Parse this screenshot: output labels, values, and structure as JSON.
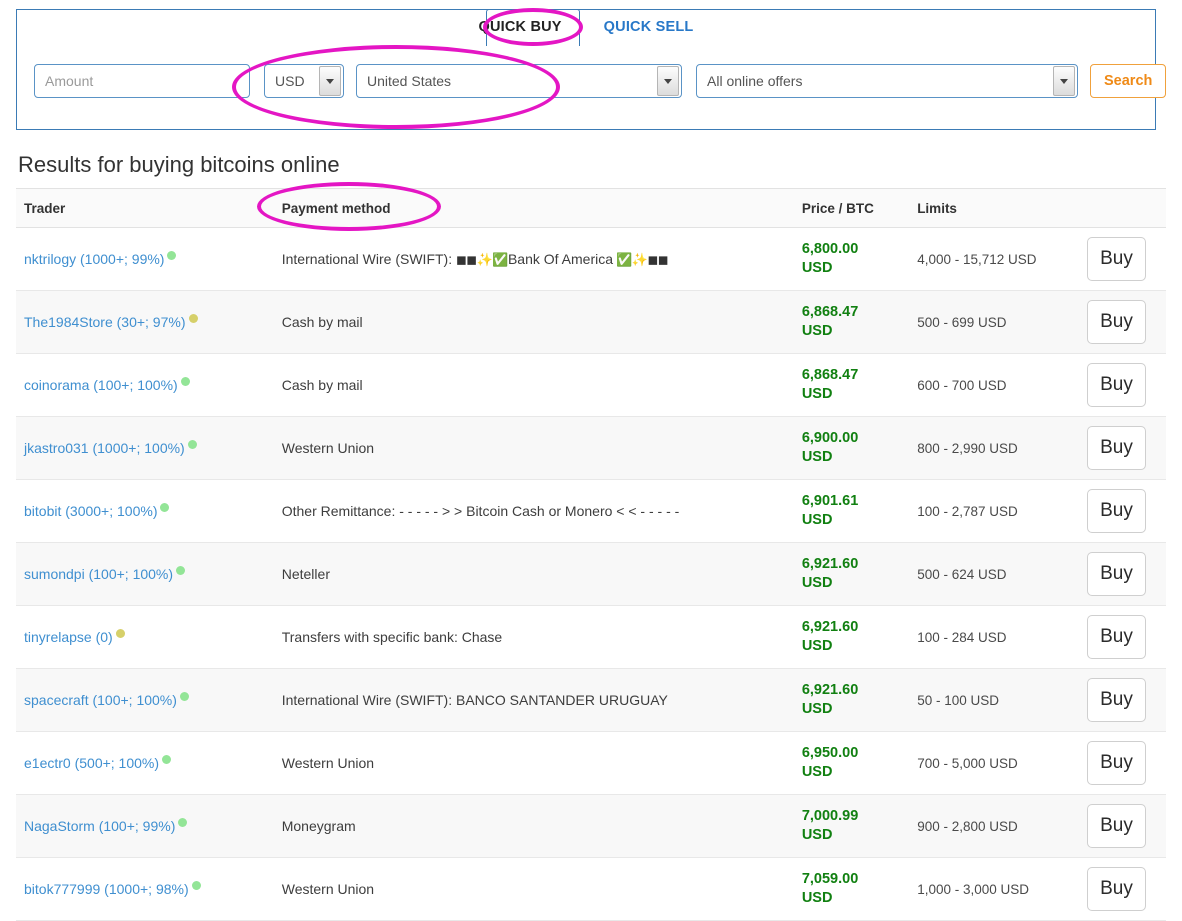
{
  "tabs": [
    {
      "label": "QUICK BUY",
      "state": "active"
    },
    {
      "label": "QUICK SELL",
      "state": "inactive"
    }
  ],
  "search": {
    "amount_placeholder": "Amount",
    "currency_value": "USD",
    "country_value": "United States",
    "offers_value": "All online offers",
    "search_label": "Search"
  },
  "results": {
    "heading": "Results for buying bitcoins online",
    "columns": [
      "Trader",
      "Payment method",
      "Price / BTC",
      "Limits",
      ""
    ],
    "buy_label": "Buy",
    "rows": [
      {
        "trader": "nktrilogy (1000+; 99%)",
        "status": "green",
        "payment": "International Wire (SWIFT): ",
        "payment_emoji_pre": "◼◼✨✅",
        "payment_bank": "Bank Of America",
        "payment_emoji_post": " ✅✨◼◼",
        "price": "6,800.00",
        "currency": "USD",
        "limits": "4,000 - 15,712 USD"
      },
      {
        "trader": "The1984Store (30+; 97%)",
        "status": "yellow",
        "payment": "Cash by mail",
        "price": "6,868.47",
        "currency": "USD",
        "limits": "500 - 699 USD"
      },
      {
        "trader": "coinorama (100+; 100%)",
        "status": "green",
        "payment": "Cash by mail",
        "price": "6,868.47",
        "currency": "USD",
        "limits": "600 - 700 USD"
      },
      {
        "trader": "jkastro031 (1000+; 100%)",
        "status": "green",
        "payment": "Western Union",
        "price": "6,900.00",
        "currency": "USD",
        "limits": "800 - 2,990 USD"
      },
      {
        "trader": "bitobit (3000+; 100%)",
        "status": "green",
        "payment": "Other Remittance: - - - - - > > Bitcoin Cash or Monero < < - - - - -",
        "price": "6,901.61",
        "currency": "USD",
        "limits": "100 - 2,787 USD"
      },
      {
        "trader": "sumondpi (100+; 100%)",
        "status": "green",
        "payment": "Neteller",
        "price": "6,921.60",
        "currency": "USD",
        "limits": "500 - 624 USD"
      },
      {
        "trader": "tinyrelapse (0)",
        "status": "yellow",
        "payment": "Transfers with specific bank: Chase",
        "price": "6,921.60",
        "currency": "USD",
        "limits": "100 - 284 USD"
      },
      {
        "trader": "spacecraft (100+; 100%)",
        "status": "green",
        "payment": "International Wire (SWIFT): BANCO SANTANDER URUGUAY",
        "price": "6,921.60",
        "currency": "USD",
        "limits": "50 - 100 USD"
      },
      {
        "trader": "e1ectr0 (500+; 100%)",
        "status": "green",
        "payment": "Western Union",
        "price": "6,950.00",
        "currency": "USD",
        "limits": "700 - 5,000 USD"
      },
      {
        "trader": "NagaStorm (100+; 99%)",
        "status": "green",
        "payment": "Moneygram",
        "price": "7,000.99",
        "currency": "USD",
        "limits": "900 - 2,800 USD"
      },
      {
        "trader": "bitok777999 (1000+; 98%)",
        "status": "green",
        "payment": "Western Union",
        "price": "7,059.00",
        "currency": "USD",
        "limits": "1,000 - 3,000 USD"
      }
    ]
  },
  "annotations": {
    "color": "#e416c4",
    "targets": [
      "QUICK BUY",
      "currency-and-country",
      "Payment method"
    ]
  }
}
